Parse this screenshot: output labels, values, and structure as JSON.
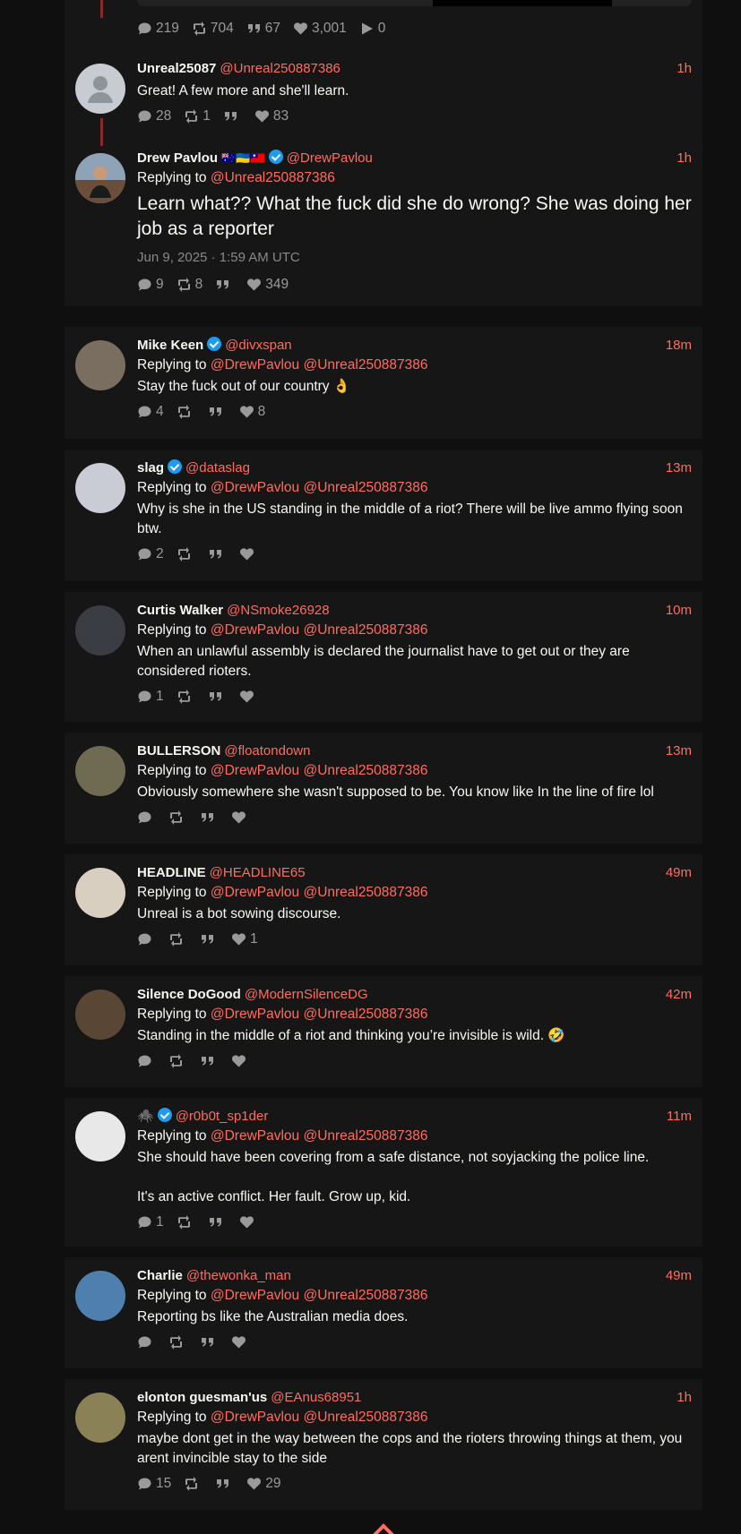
{
  "top_tweet_stats": {
    "comments": "219",
    "retweets": "704",
    "quotes": "67",
    "likes": "3,001",
    "plays": "0"
  },
  "parent_tweets": [
    {
      "fullname": "Unreal25087",
      "username": "@Unreal250887386",
      "time": "1h",
      "body": "Great! A few more and she'll learn.",
      "stats": {
        "comments": "28",
        "retweets": "1",
        "quotes": "",
        "likes": "83"
      }
    },
    {
      "fullname": "Drew Pavlou",
      "flags": "🇦🇺🇺🇦🇹🇼",
      "username": "@DrewPavlou",
      "time": "1h",
      "replying_label": "Replying to",
      "replying_to": "@Unreal250887386",
      "body": "Learn what?? What the fuck did she do wrong? She was doing her job as a reporter",
      "date": "Jun 9, 2025 · 1:59 AM UTC",
      "stats": {
        "comments": "9",
        "retweets": "8",
        "quotes": "",
        "likes": "349"
      }
    }
  ],
  "replies": [
    {
      "fullname": "Mike Keen",
      "verified": true,
      "username": "@divxspan",
      "time": "18m",
      "replying_label": "Replying to",
      "replying_to": "@DrewPavlou @Unreal250887386",
      "body": "Stay the fuck out of our country 👌",
      "stats": {
        "comments": "4",
        "retweets": "",
        "quotes": "",
        "likes": "8"
      },
      "avatar_color": "#7a6e60"
    },
    {
      "fullname": "slag",
      "verified": true,
      "username": "@dataslag",
      "time": "13m",
      "replying_label": "Replying to",
      "replying_to": "@DrewPavlou @Unreal250887386",
      "body": "Why is she in the US standing in the middle of a riot? There will be live ammo flying soon btw.",
      "stats": {
        "comments": "2",
        "retweets": "",
        "quotes": "",
        "likes": ""
      },
      "avatar_color": "#c9ccd4"
    },
    {
      "fullname": "Curtis Walker",
      "verified": false,
      "username": "@NSmoke26928",
      "time": "10m",
      "replying_label": "Replying to",
      "replying_to": "@DrewPavlou @Unreal250887386",
      "body": "When an unlawful assembly is declared the journalist have to get out or they are considered rioters.",
      "stats": {
        "comments": "1",
        "retweets": "",
        "quotes": "",
        "likes": ""
      },
      "avatar_color": "#3b3d44"
    },
    {
      "fullname": "BULLERSON",
      "verified": false,
      "username": "@floatondown",
      "time": "13m",
      "replying_label": "Replying to",
      "replying_to": "@DrewPavlou @Unreal250887386",
      "body": "Obviously somewhere she wasn't supposed to be. You know like In the line of fire lol",
      "stats": {
        "comments": "",
        "retweets": "",
        "quotes": "",
        "likes": ""
      },
      "avatar_color": "#6f6a52"
    },
    {
      "fullname": "HEADLINE",
      "verified": false,
      "username": "@HEADLINE65",
      "time": "49m",
      "replying_label": "Replying to",
      "replying_to": "@DrewPavlou @Unreal250887386",
      "body": "Unreal is a bot sowing discourse.",
      "stats": {
        "comments": "",
        "retweets": "",
        "quotes": "",
        "likes": "1"
      },
      "avatar_color": "#d8cfc0"
    },
    {
      "fullname": "Silence DoGood",
      "verified": false,
      "username": "@ModernSilenceDG",
      "time": "42m",
      "replying_label": "Replying to",
      "replying_to": "@DrewPavlou @Unreal250887386",
      "body": "Standing in the middle of a riot and thinking you’re invisible is wild. 🤣",
      "stats": {
        "comments": "",
        "retweets": "",
        "quotes": "",
        "likes": ""
      },
      "avatar_color": "#5a4634"
    },
    {
      "fullname": "🕷️",
      "verified": true,
      "username": "@r0b0t_sp1der",
      "time": "11m",
      "replying_label": "Replying to",
      "replying_to": "@DrewPavlou @Unreal250887386",
      "body": "She should have been covering from a safe distance, not soyjacking the police line.\n\nIt's an active conflict. Her fault. Grow up, kid.",
      "stats": {
        "comments": "1",
        "retweets": "",
        "quotes": "",
        "likes": ""
      },
      "avatar_color": "#e8e8e8"
    },
    {
      "fullname": "Charlie",
      "verified": false,
      "username": "@thewonka_man",
      "time": "49m",
      "replying_label": "Replying to",
      "replying_to": "@DrewPavlou @Unreal250887386",
      "body": "Reporting bs like the Australian media does.",
      "stats": {
        "comments": "",
        "retweets": "",
        "quotes": "",
        "likes": ""
      },
      "avatar_color": "#4f7fae"
    },
    {
      "fullname": "elonton guesman'us",
      "verified": false,
      "username": "@EAnus68951",
      "time": "1h",
      "replying_label": "Replying to",
      "replying_to": "@DrewPavlou @Unreal250887386",
      "body": "maybe dont get in the way between the cops and the rioters throwing things at them, you arent invincible stay to the side",
      "stats": {
        "comments": "15",
        "retweets": "",
        "quotes": "",
        "likes": "29"
      },
      "avatar_color": "#8a8256"
    }
  ],
  "colors": {
    "accent": "#ff6c60",
    "card": "#161616",
    "background": "#0f0f0f",
    "muted": "#9a9a9a",
    "verified": "#1d9bf0"
  },
  "icons": [
    "comment-icon",
    "retweet-icon",
    "quote-icon",
    "heart-icon",
    "play-icon",
    "verified-icon",
    "scroll-top-icon"
  ]
}
